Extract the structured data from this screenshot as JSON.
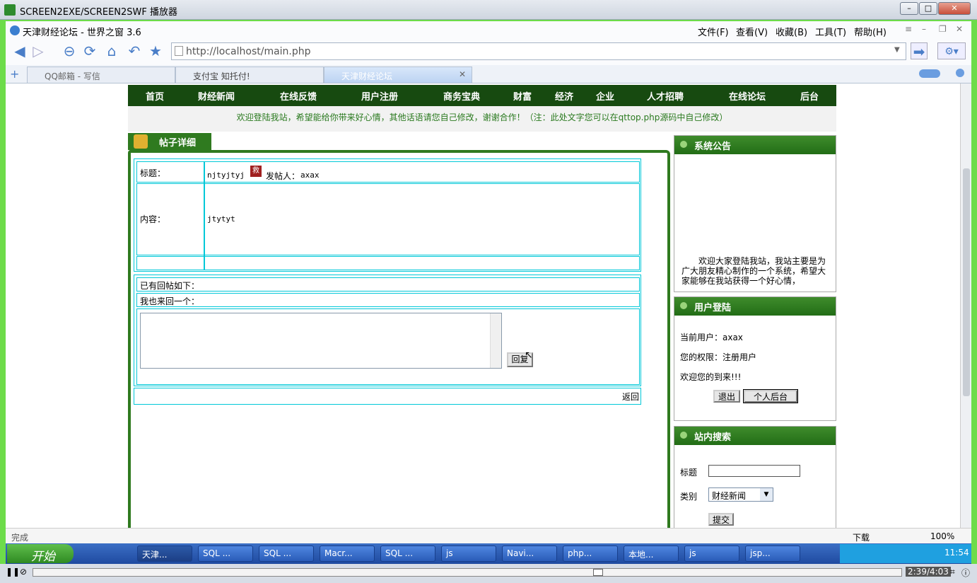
{
  "outer": {
    "title": "SCREEN2EXE/SCREEN2SWF 播放器"
  },
  "browser": {
    "title": "天津财经论坛 - 世界之窗 3.6",
    "menu": [
      "文件(F)",
      "查看(V)",
      "收藏(B)",
      "工具(T)",
      "帮助(H)"
    ],
    "url": "http://localhost/main.php",
    "tabs": [
      "QQ邮箱 - 写信",
      "支付宝 知托付!",
      "天津财经论坛"
    ],
    "status": "完成",
    "download": "下载",
    "zoom": "100%"
  },
  "site": {
    "nav": [
      "首页",
      "财经新闻",
      "在线反馈",
      "用户注册",
      "商务宝典",
      "财富",
      "经济",
      "企业",
      "人才招聘",
      "在线论坛",
      "后台"
    ],
    "welcome": "欢迎登陆我站，希望能给你带来好心情，其他话语请您自己修改，谢谢合作！（注：此处文字您可以在qttop.php源码中自己修改）"
  },
  "post": {
    "tab_title": "帖子详细",
    "title_label": "标题：",
    "title_value": "njtyjtyj",
    "badge": "救",
    "author_label": "发帖人：",
    "author_value": "axax",
    "content_label": "内容：",
    "content_value": "jtytyt",
    "replies_label": "已有回帖如下：",
    "reply_prompt": "我也来回一个：",
    "reply_button": "回复",
    "back_link": "返回"
  },
  "sidebar": {
    "notice_title": "系统公告",
    "notice_text": "欢迎大家登陆我站，我站主要是为广大朋友精心制作的一个系统，希望大家能够在我站获得一个好心情，",
    "login_title": "用户登陆",
    "current_user": "当前用户：axax",
    "permission": "您的权限：注册用户",
    "welcome_back": "欢迎您的到来!!!",
    "logout_button": "退出",
    "profile_button": "个人后台",
    "search_title": "站内搜索",
    "search_label": "标题",
    "category_label": "类别",
    "category_selected": "财经新闻",
    "submit_button": "提交"
  },
  "taskbar": {
    "start": "开始",
    "items": [
      "天津...",
      "SQL ...",
      "SQL ...",
      "Macr...",
      "SQL ...",
      "js",
      "Navi...",
      "php...",
      "本地...",
      "js",
      "jsp..."
    ],
    "clock": "11:54"
  },
  "player": {
    "time": "2:39/4:03"
  }
}
